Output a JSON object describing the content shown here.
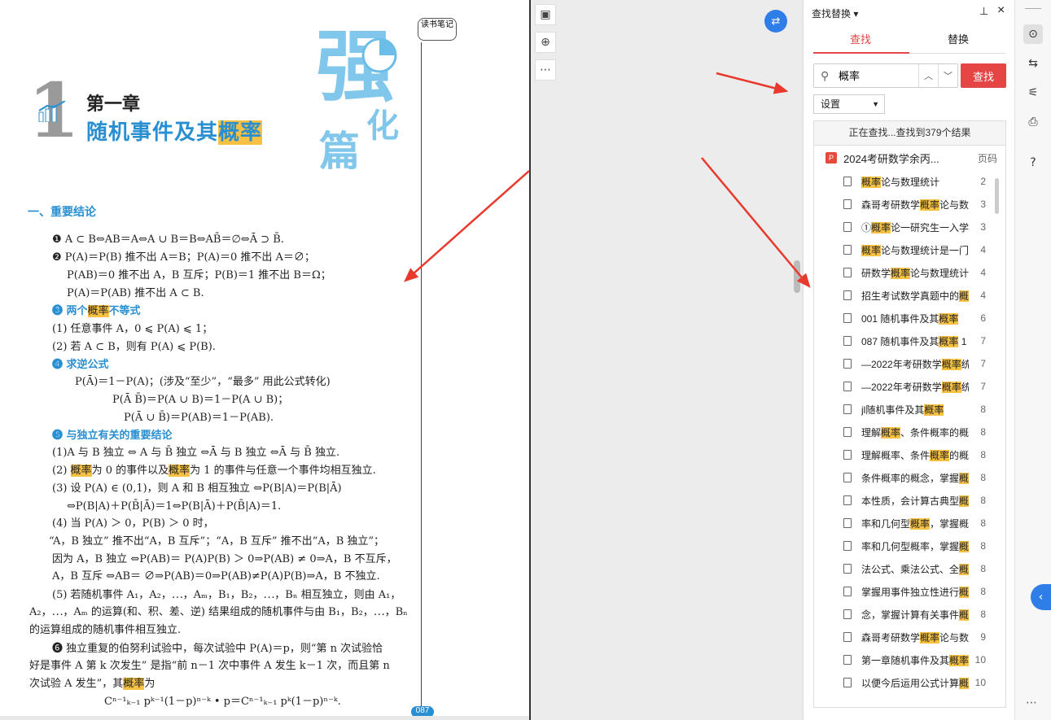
{
  "document": {
    "chapter_number": "1",
    "chapter_label": "第一章",
    "chapter_title_pre": "随机事件及其",
    "chapter_title_hl": "概率",
    "reading_badge": "读书笔记",
    "decor_chars": [
      "强",
      "化",
      "篇"
    ],
    "section_heading": "一、重要结论",
    "lines": [
      {
        "pre": "❶ A ⊂ B⇔AB＝A⇔A ∪ B＝B⇔AB̄＝∅⇔Ā ⊃ B̄."
      },
      {
        "pre": "❷ P(A)＝P(B) 推不出 A＝B；P(A)＝0 推不出 A＝∅；"
      },
      {
        "pre": "P(AB)＝0 推不出 A，B 互斥；P(B)＝1 推不出 B＝Ω；"
      },
      {
        "pre": "P(A)＝P(AB) 推不出 A ⊂ B."
      },
      {
        "pre": "❸ 两个",
        "hl": "概率",
        "post": "不等式"
      },
      {
        "pre": "(1) 任意事件 A，0 ⩽ P(A) ⩽ 1；"
      },
      {
        "pre": "(2) 若 A ⊂ B，则有 P(A) ⩽ P(B)."
      },
      {
        "pre": "❹ 求逆公式"
      },
      {
        "pre": "P(Ā)＝1－P(A)；(涉及“至少”，“最多” 用此公式转化)"
      },
      {
        "pre": "P(Ā B̄)＝P(A ∪ B)＝1－P(A ∪ B)；"
      },
      {
        "pre": "P(Ā ∪ B̄)＝P(AB)＝1－P(AB)."
      },
      {
        "pre": "❺ 与独立有关的重要结论"
      },
      {
        "pre": "(1)A 与 B 独立 ⇔ A 与 B̄ 独立 ⇔Ā 与 B 独立 ⇔Ā 与 B̄ 独立."
      },
      {
        "pre": "(2) ",
        "hl": "概率",
        "post": "为 0 的事件以及",
        "hl2": "概率",
        "post2": "为 1 的事件与任意一个事件均相互独立."
      },
      {
        "pre": "(3) 设 P(A) ∈ (0,1)，则 A 和 B 相互独立 ⇔P(B|A)＝P(B|Ā)"
      },
      {
        "pre": "⇔P(B|A)＋P(B̄|Ā)＝1⇔P(B|Ā)＋P(B̄|A)＝1."
      },
      {
        "pre": "(4) 当 P(A) ＞ 0，P(B) ＞ 0 时，"
      },
      {
        "pre": "“A，B 独立” 推不出“A，B 互斥”；“A，B 互斥” 推不出“A，B 独立”；"
      },
      {
        "pre": "因为 A，B 独立 ⇔P(AB)＝ P(A)P(B) ＞ 0⇒P(AB) ≠ 0⇒A，B 不互斥，"
      },
      {
        "pre": "A，B 互斥 ⇔AB＝ ∅⇒P(AB)＝0⇒P(AB)≠P(A)P(B)⇒A，B 不独立."
      },
      {
        "pre": "(5) 若随机事件 A₁，A₂，⋯，Aₘ，B₁，B₂，⋯，Bₙ 相互独立，则由 A₁，"
      },
      {
        "pre": "A₂，⋯，Aₘ 的运算(和、积、差、逆) 结果组成的随机事件与由 B₁，B₂，⋯，Bₙ"
      },
      {
        "pre": "的运算组成的随机事件相互独立."
      },
      {
        "pre": "❻ 独立重复的伯努利试验中，每次试验中 P(A)＝p，则“第 n 次试验恰"
      },
      {
        "pre": "好是事件 A 第 k 次发生” 是指“前 n－1 次中事件 A 发生 k－1 次，而且第 n"
      },
      {
        "pre": "次试验 A 发生”，其",
        "hl": "概率",
        "post": "为"
      },
      {
        "pre": "Cⁿ⁻¹ₖ₋₁ pᵏ⁻¹(1－p)ⁿ⁻ᵏ • p＝Cⁿ⁻¹ₖ₋₁ pᵏ(1－p)ⁿ⁻ᵏ."
      }
    ],
    "page_number": "087"
  },
  "panel": {
    "title": "查找替换",
    "tabs": {
      "find": "查找",
      "replace": "替换"
    },
    "search_value": "概率",
    "find_button": "查找",
    "settings_label": "设置",
    "status": "正在查找...查找到379个结果",
    "doc_name": "2024考研数学余丙...",
    "page_col": "页码",
    "results": [
      {
        "pre": "",
        "hl": "概率",
        "post": "论与数理统计",
        "page": "2"
      },
      {
        "pre": "森哥考研数学",
        "hl": "概率",
        "post": "论与数",
        "page": "3"
      },
      {
        "pre": "①",
        "hl": "概率",
        "post": "论一研究生一入学",
        "page": "3"
      },
      {
        "pre": "",
        "hl": "概率",
        "post": "论与数理统计是一门",
        "page": "4"
      },
      {
        "pre": "研数学",
        "hl": "概率",
        "post": "论与数理统计",
        "page": "4"
      },
      {
        "pre": "招生考试数学真题中的",
        "hl": "概",
        "post": "",
        "page": "4"
      },
      {
        "pre": "001 随机事件及其",
        "hl": "概率",
        "post": "",
        "page": "6"
      },
      {
        "pre": "087 随机事件及其",
        "hl": "概率",
        "post": " 1",
        "page": "7"
      },
      {
        "pre": "—2022年考研数学",
        "hl": "概率",
        "post": "统",
        "page": "7"
      },
      {
        "pre": "—2022年考研数学",
        "hl": "概率",
        "post": "统",
        "page": "7"
      },
      {
        "pre": "jl随机事件及其",
        "hl": "概率",
        "post": "",
        "page": "8"
      },
      {
        "pre": "理解",
        "hl": "概率",
        "post": "、条件概率的概",
        "page": "8"
      },
      {
        "pre": "理解概率、条件",
        "hl": "概率",
        "post": "的概",
        "page": "8"
      },
      {
        "pre": "条件概率的概念，掌握",
        "hl": "概",
        "post": "",
        "page": "8"
      },
      {
        "pre": "本性质，会计算古典型",
        "hl": "概",
        "post": "",
        "page": "8"
      },
      {
        "pre": "率和几何型",
        "hl": "概率",
        "post": "，掌握概",
        "page": "8"
      },
      {
        "pre": "率和几何型概率，掌握",
        "hl": "概",
        "post": "",
        "page": "8"
      },
      {
        "pre": "法公式、乘法公式、全",
        "hl": "概",
        "post": "",
        "page": "8"
      },
      {
        "pre": "掌握用事件独立性进行",
        "hl": "概",
        "post": "",
        "page": "8"
      },
      {
        "pre": "念，掌握计算有关事件",
        "hl": "概",
        "post": "",
        "page": "8"
      },
      {
        "pre": "森哥考研数学",
        "hl": "概率",
        "post": "论与数",
        "page": "9"
      },
      {
        "pre": "第一章随机事件及其",
        "hl": "概率",
        "post": "",
        "page": "10"
      },
      {
        "pre": "以便今后运用公式计算",
        "hl": "概",
        "post": "",
        "page": "10"
      }
    ]
  },
  "colors": {
    "accent": "#e54545",
    "blue": "#2a8fd0",
    "highlight": "#f7c244"
  }
}
